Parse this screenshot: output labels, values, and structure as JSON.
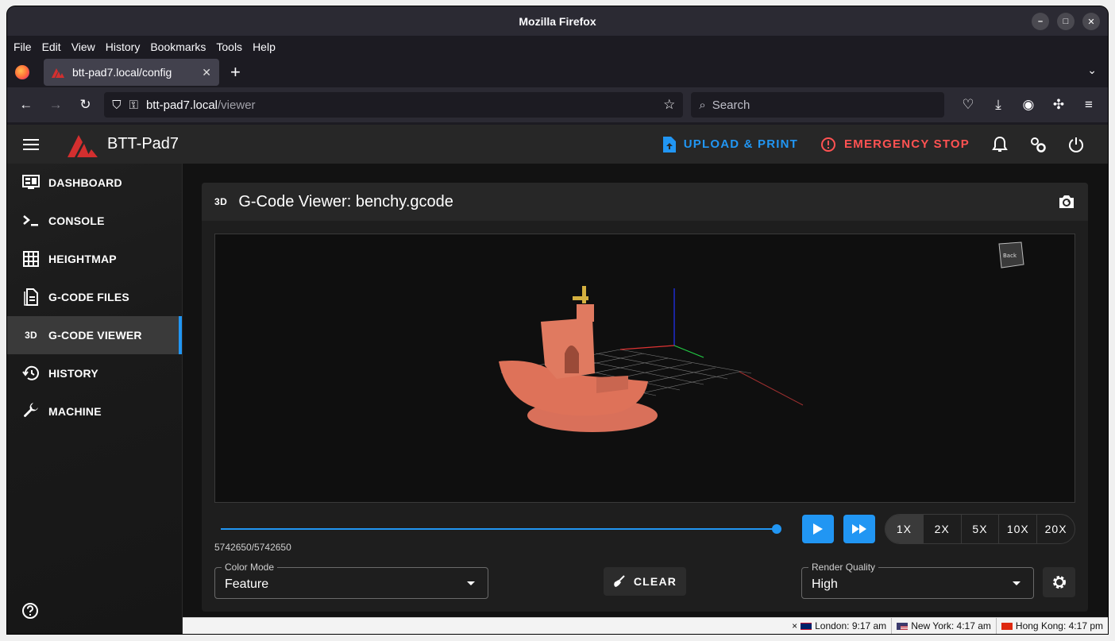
{
  "window": {
    "title": "Mozilla Firefox"
  },
  "menu": [
    "File",
    "Edit",
    "View",
    "History",
    "Bookmarks",
    "Tools",
    "Help"
  ],
  "tab": {
    "title": "btt-pad7.local/config"
  },
  "urlbar": {
    "host": "btt-pad7.local",
    "path": "/viewer"
  },
  "searchbar": {
    "placeholder": "Search"
  },
  "appbar": {
    "brand": "BTT-Pad7",
    "upload_label": "UPLOAD & PRINT",
    "estop_label": "EMERGENCY STOP"
  },
  "sidebar": {
    "items": [
      {
        "label": "DASHBOARD",
        "icon": "monitor-dashboard-icon"
      },
      {
        "label": "CONSOLE",
        "icon": "console-icon"
      },
      {
        "label": "HEIGHTMAP",
        "icon": "grid-icon"
      },
      {
        "label": "G-CODE FILES",
        "icon": "file-document-icon"
      },
      {
        "label": "G-CODE VIEWER",
        "icon": "3d-icon",
        "badge": "3D"
      },
      {
        "label": "HISTORY",
        "icon": "history-icon"
      },
      {
        "label": "MACHINE",
        "icon": "wrench-icon"
      }
    ],
    "active_index": 4
  },
  "viewer": {
    "badge": "3D",
    "title": "G-Code Viewer: benchy.gcode",
    "cube_label": "Back",
    "progress_text": "5742650/5742650",
    "progress_fraction": 1.0,
    "speeds": [
      "1X",
      "2X",
      "5X",
      "10X",
      "20X"
    ],
    "active_speed": "1X",
    "color_mode_label": "Color Mode",
    "color_mode_value": "Feature",
    "clear_label": "CLEAR",
    "render_quality_label": "Render Quality",
    "render_quality_value": "High",
    "model_color": "#e07050",
    "accent": "#2196f3"
  },
  "statusbar": {
    "close_glyph": "×",
    "clocks": [
      {
        "text": "London: 9:17 am"
      },
      {
        "text": "New York: 4:17 am"
      },
      {
        "text": "Hong Kong: 4:17 pm"
      }
    ]
  }
}
